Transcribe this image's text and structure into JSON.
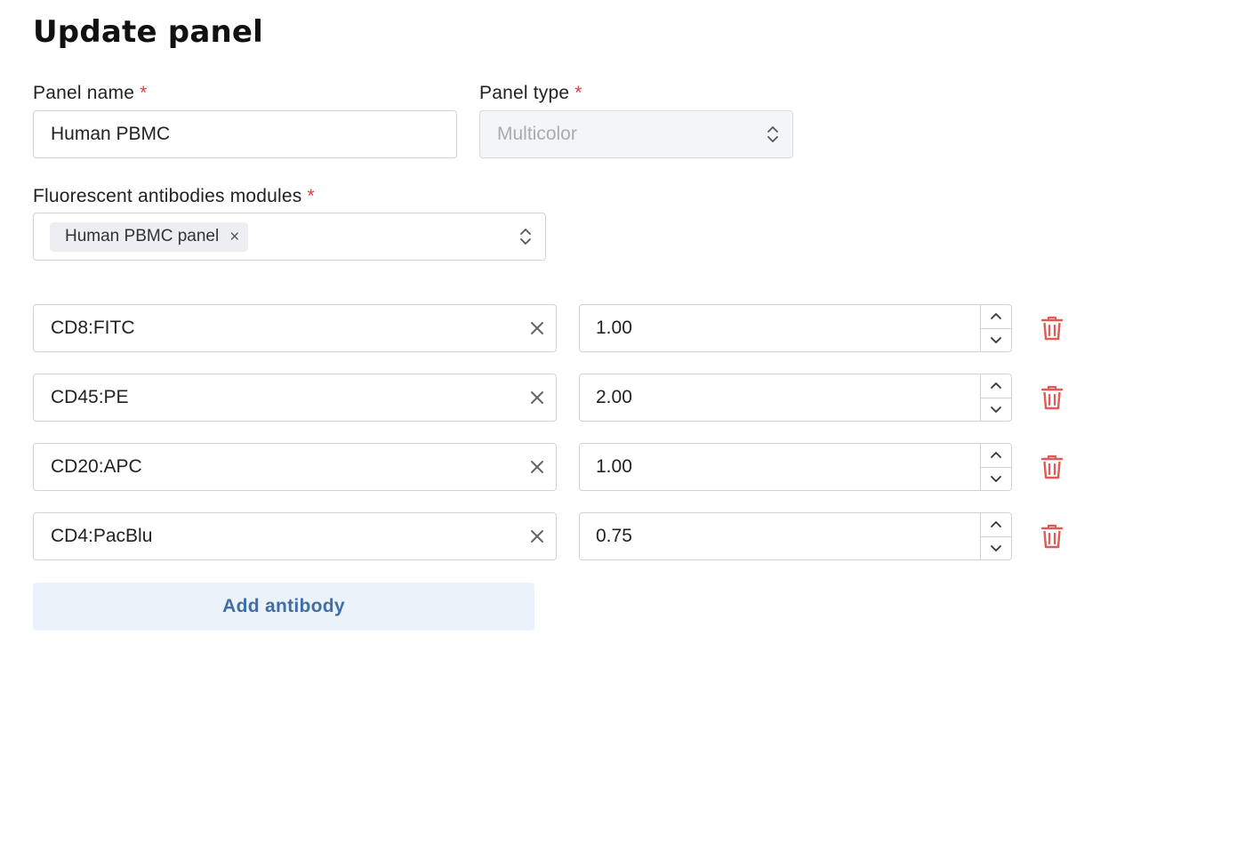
{
  "page": {
    "title": "Update panel"
  },
  "form": {
    "panel_name": {
      "label": "Panel name",
      "required_mark": "*",
      "value": "Human PBMC"
    },
    "panel_type": {
      "label": "Panel type",
      "required_mark": "*",
      "value": "Multicolor",
      "disabled": true
    },
    "modules": {
      "label": "Fluorescent antibodies modules",
      "required_mark": "*",
      "selected": [
        {
          "label": "Human PBMC panel",
          "remove_glyph": "×"
        }
      ]
    }
  },
  "antibodies": [
    {
      "name": "CD8:FITC",
      "amount": "1.00"
    },
    {
      "name": "CD45:PE",
      "amount": "2.00"
    },
    {
      "name": "CD20:APC",
      "amount": "1.00"
    },
    {
      "name": "CD4:PacBlu",
      "amount": "0.75"
    }
  ],
  "actions": {
    "add_antibody": "Add antibody"
  },
  "colors": {
    "required": "#e0413a",
    "delete_icon": "#e25a55",
    "add_button_bg": "#ebf2fa",
    "add_button_text": "#3f6ea8",
    "border": "#cfd3d8"
  },
  "icons": {
    "select_indicator": "updown-chevron-icon",
    "clear": "close-icon",
    "increment": "chevron-up-icon",
    "decrement": "chevron-down-icon",
    "delete": "trash-icon"
  }
}
